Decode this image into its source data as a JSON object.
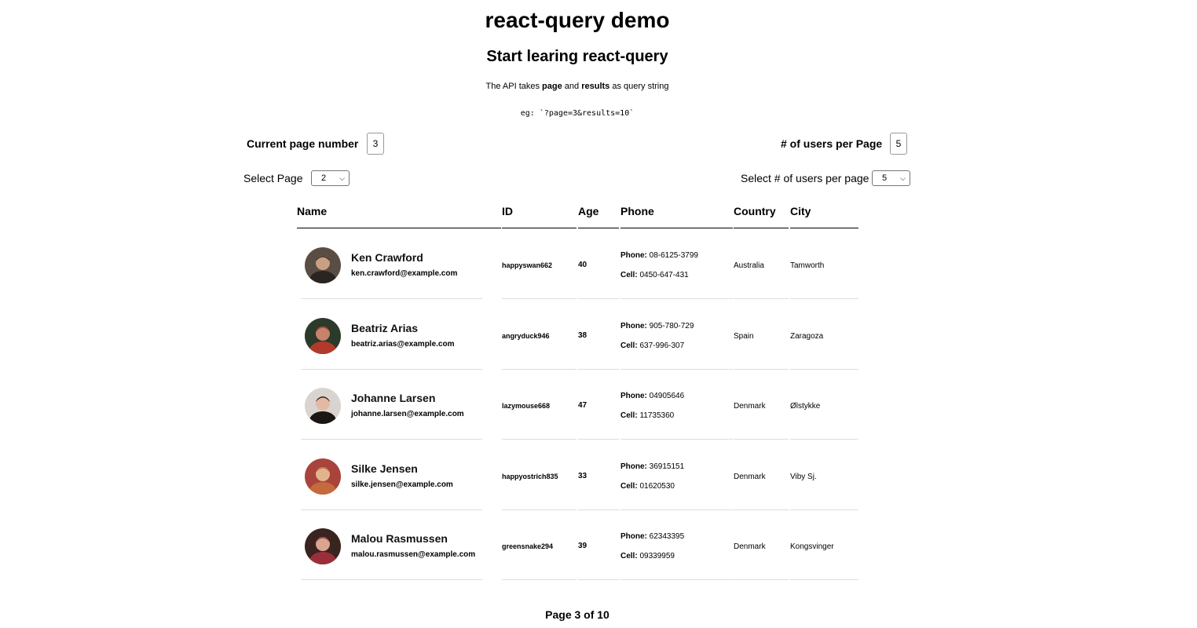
{
  "header": {
    "title": "react-query demo",
    "subtitle": "Start learing react-query",
    "api_note": {
      "prefix": "The API takes ",
      "param1": "page",
      "middle": " and ",
      "param2": "results",
      "suffix": " as query string"
    },
    "example": "eg: `?page=3&results=10`"
  },
  "controls": {
    "current_page_label": "Current page number",
    "current_page_value": "3",
    "users_per_page_label": "# of users per Page",
    "users_per_page_value": "5",
    "select_page_label": "Select Page",
    "select_page_value": "2",
    "select_users_label": "Select # of users per page",
    "select_users_value": "5"
  },
  "table": {
    "columns": [
      "Name",
      "ID",
      "Age",
      "Phone",
      "Country",
      "City"
    ],
    "phone_prefix": "Phone:",
    "cell_prefix": "Cell:",
    "rows": [
      {
        "name": "Ken Crawford",
        "email": "ken.crawford@example.com",
        "id": "happyswan662",
        "age": "40",
        "phone": "08-6125-3799",
        "cell": "0450-647-431",
        "country": "Australia",
        "city": "Tamworth",
        "avatar_colors": [
          "#5a4e44",
          "#c9a082",
          "#2a2522"
        ]
      },
      {
        "name": "Beatriz Arias",
        "email": "beatriz.arias@example.com",
        "id": "angryduck946",
        "age": "38",
        "phone": "905-780-729",
        "cell": "637-996-307",
        "country": "Spain",
        "city": "Zaragoza",
        "avatar_colors": [
          "#2b3a2a",
          "#c7826b",
          "#b23a2a"
        ]
      },
      {
        "name": "Johanne Larsen",
        "email": "johanne.larsen@example.com",
        "id": "lazymouse668",
        "age": "47",
        "phone": "04905646",
        "cell": "11735360",
        "country": "Denmark",
        "city": "Ølstykke",
        "avatar_colors": [
          "#d9d4cf",
          "#e3b9a4",
          "#1b1514"
        ]
      },
      {
        "name": "Silke Jensen",
        "email": "silke.jensen@example.com",
        "id": "happyostrich835",
        "age": "33",
        "phone": "36915151",
        "cell": "01620530",
        "country": "Denmark",
        "city": "Viby Sj.",
        "avatar_colors": [
          "#a8443b",
          "#e0b48f",
          "#c46a3c"
        ]
      },
      {
        "name": "Malou Rasmussen",
        "email": "malou.rasmussen@example.com",
        "id": "greensnake294",
        "age": "39",
        "phone": "62343395",
        "cell": "09339959",
        "country": "Denmark",
        "city": "Kongsvinger",
        "avatar_colors": [
          "#3a2420",
          "#d9a58f",
          "#9a2f3a"
        ]
      }
    ]
  },
  "pagination": {
    "text": "Page 3 of 10"
  }
}
